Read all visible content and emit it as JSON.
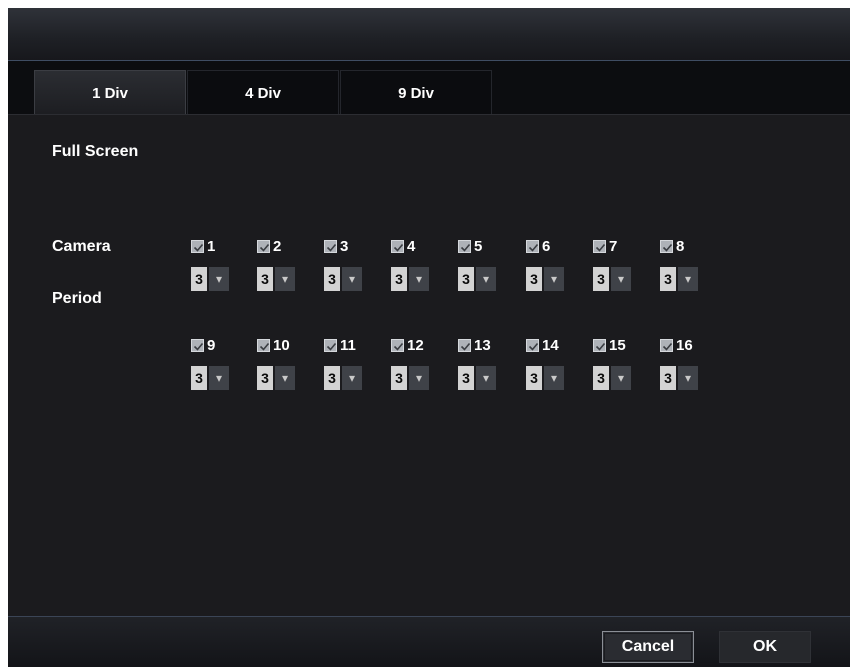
{
  "tabs": [
    {
      "label": "1 Div",
      "active": true
    },
    {
      "label": "4 Div",
      "active": false
    },
    {
      "label": "9 Div",
      "active": false
    }
  ],
  "mode_label": "Full Screen",
  "camera_label": "Camera",
  "period_label": "Period",
  "cameras": [
    {
      "num": "1",
      "checked": true,
      "period": "3"
    },
    {
      "num": "2",
      "checked": true,
      "period": "3"
    },
    {
      "num": "3",
      "checked": true,
      "period": "3"
    },
    {
      "num": "4",
      "checked": true,
      "period": "3"
    },
    {
      "num": "5",
      "checked": true,
      "period": "3"
    },
    {
      "num": "6",
      "checked": true,
      "period": "3"
    },
    {
      "num": "7",
      "checked": true,
      "period": "3"
    },
    {
      "num": "8",
      "checked": true,
      "period": "3"
    },
    {
      "num": "9",
      "checked": true,
      "period": "3"
    },
    {
      "num": "10",
      "checked": true,
      "period": "3"
    },
    {
      "num": "11",
      "checked": true,
      "period": "3"
    },
    {
      "num": "12",
      "checked": true,
      "period": "3"
    },
    {
      "num": "13",
      "checked": true,
      "period": "3"
    },
    {
      "num": "14",
      "checked": true,
      "period": "3"
    },
    {
      "num": "15",
      "checked": true,
      "period": "3"
    },
    {
      "num": "16",
      "checked": true,
      "period": "3"
    }
  ],
  "buttons": {
    "cancel": "Cancel",
    "ok": "OK"
  },
  "colors": {
    "background": "#1b1b1e",
    "tab_active": "#2b2d32",
    "checkbox": "#aeb2b8",
    "dropdown_value": "#d3d3d3",
    "dropdown_arrow": "#3f4248"
  }
}
